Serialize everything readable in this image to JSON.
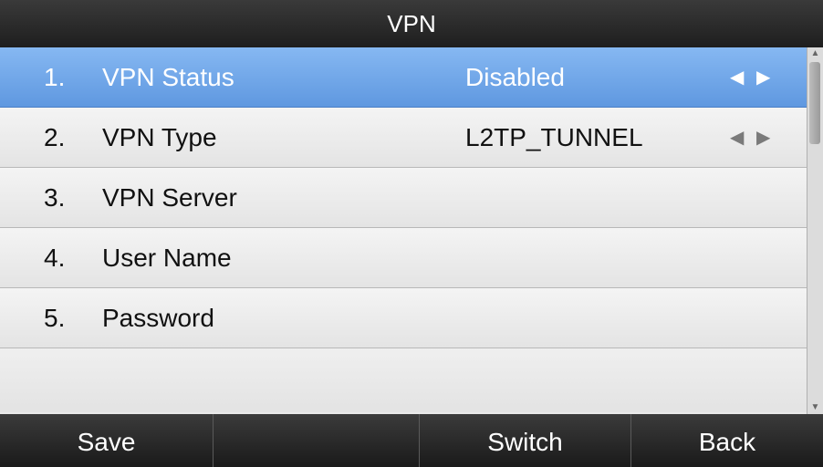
{
  "title": "VPN",
  "rows": [
    {
      "number": "1.",
      "label": "VPN Status",
      "value": "Disabled",
      "has_arrows": true,
      "selected": true
    },
    {
      "number": "2.",
      "label": "VPN Type",
      "value": "L2TP_TUNNEL",
      "has_arrows": true,
      "selected": false
    },
    {
      "number": "3.",
      "label": "VPN Server",
      "value": "",
      "has_arrows": false,
      "selected": false
    },
    {
      "number": "4.",
      "label": "User Name",
      "value": "",
      "has_arrows": false,
      "selected": false
    },
    {
      "number": "5.",
      "label": "Password",
      "value": "",
      "has_arrows": false,
      "selected": false
    }
  ],
  "arrows": {
    "left": "◀",
    "right": "▶"
  },
  "scrollbar": {
    "up": "▲",
    "down": "▼",
    "position": 0
  },
  "softkeys": {
    "key1": "Save",
    "key2": "",
    "key3": "Switch",
    "key4": "Back"
  },
  "colors": {
    "selected_row": "#6fa6e8",
    "title_bar": "#2a2a2a",
    "row_background": "#ececec"
  }
}
